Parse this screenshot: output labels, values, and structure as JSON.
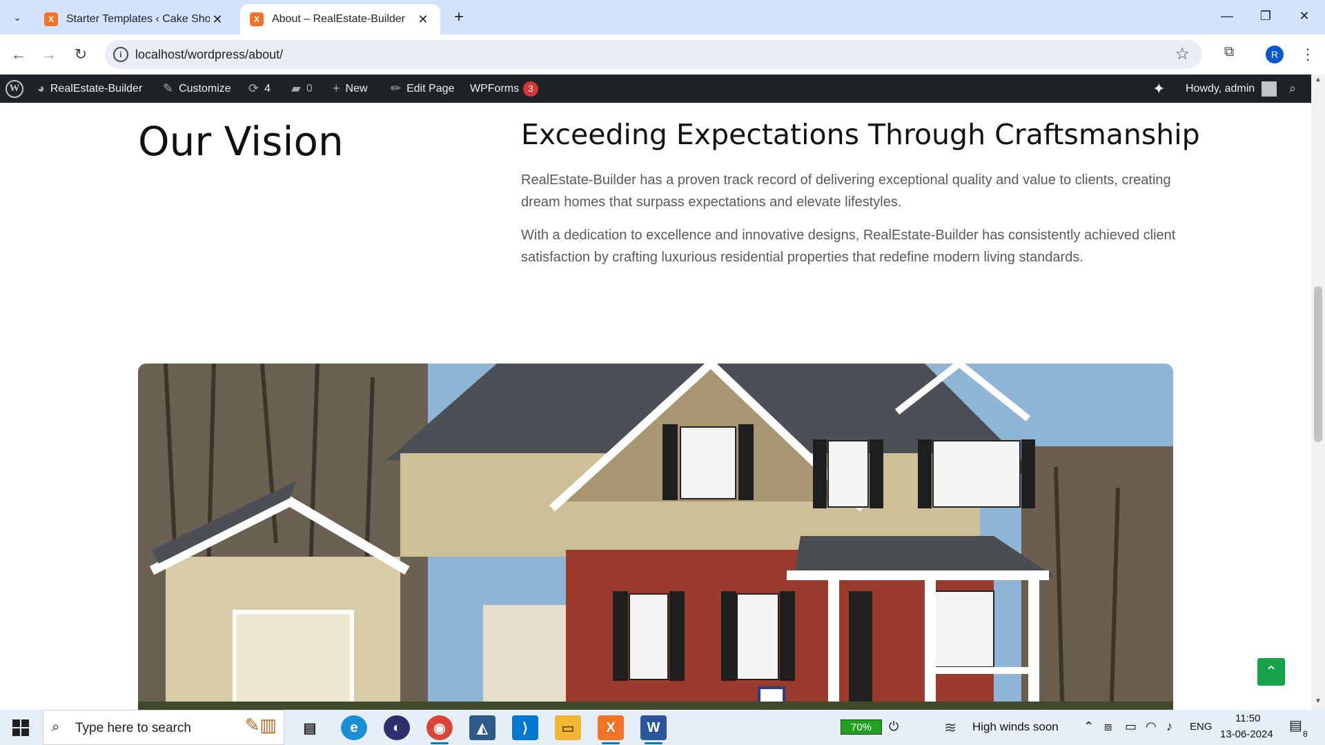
{
  "browser": {
    "tabs": [
      {
        "title": "Starter Templates ‹ Cake Shop –",
        "active": false
      },
      {
        "title": "About – RealEstate-Builder",
        "active": true
      }
    ],
    "url": "localhost/wordpress/about/",
    "profile_initial": "R"
  },
  "adminbar": {
    "site_name": "RealEstate-Builder",
    "customize": "Customize",
    "updates_count": "4",
    "comments_count": "0",
    "new_label": "New",
    "edit_page": "Edit Page",
    "wpforms": "WPForms",
    "wpforms_badge": "3",
    "howdy": "Howdy, admin"
  },
  "page": {
    "vision_heading": "Our Vision",
    "section_title": "Exceeding Expectations Through Craftsmanship",
    "paragraph_1": "RealEstate-Builder has a proven track record of delivering exceptional quality and value to clients, creating dream homes that surpass expectations and elevate lifestyles.",
    "paragraph_2": "With a dedication to excellence and innovative designs, RealEstate-Builder has consistently achieved client satisfaction by crafting luxurious residential properties that redefine modern living standards."
  },
  "taskbar": {
    "search_placeholder": "Type here to search",
    "battery": "70%",
    "weather": "High winds soon",
    "language": "ENG",
    "time": "11:50",
    "date": "13-06-2024",
    "notification_count": "8"
  },
  "colors": {
    "tab_strip": "#d3e3fd",
    "admin_bar": "#1d2327",
    "accent_green": "#16a34a",
    "badge_red": "#d63638"
  }
}
